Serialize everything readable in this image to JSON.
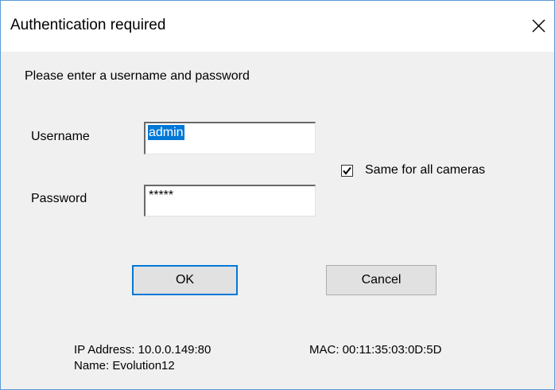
{
  "dialog": {
    "title": "Authentication required",
    "prompt": "Please enter a username and password",
    "username_label": "Username",
    "username_value": "admin",
    "password_label": "Password",
    "password_value": "*****",
    "same_for_all_label": "Same for all cameras",
    "same_for_all_checked": true,
    "ok_label": "OK",
    "cancel_label": "Cancel",
    "ip_address": "IP Address: 10.0.0.149:80",
    "mac": "MAC: 00:11:35:03:0D:5D",
    "name": "Name: Evolution12"
  },
  "icons": {
    "close": "close-icon",
    "check": "checkmark-icon"
  },
  "colors": {
    "selection": "#0078d7",
    "window_border": "#5b9bd5",
    "face": "#f0f0f0"
  }
}
